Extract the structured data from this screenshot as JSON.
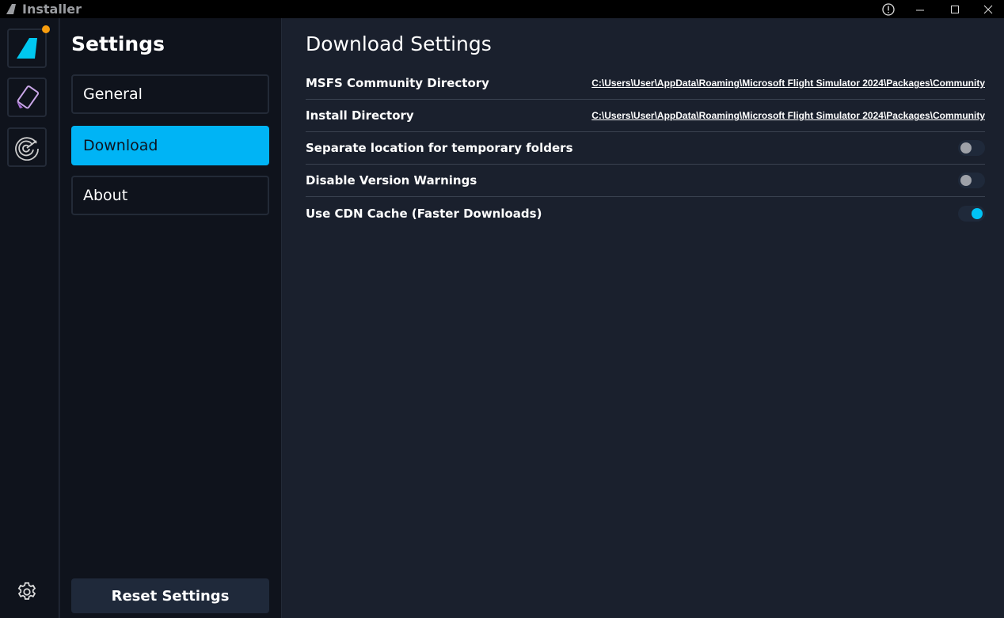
{
  "window": {
    "title": "Installer",
    "controls": [
      "info",
      "minimize",
      "maximize",
      "close"
    ]
  },
  "rail": {
    "items": [
      {
        "icon": "flybywire-logo-icon",
        "badge": true,
        "badge_color": "#f89d0e"
      },
      {
        "icon": "tablet-icon"
      },
      {
        "icon": "radar-icon"
      }
    ],
    "settings_icon": "gear-icon"
  },
  "settings": {
    "title": "Settings",
    "nav": [
      {
        "label": "General",
        "active": false
      },
      {
        "label": "Download",
        "active": true
      },
      {
        "label": "About",
        "active": false
      }
    ],
    "reset_label": "Reset Settings"
  },
  "main": {
    "title": "Download Settings",
    "rows": [
      {
        "label": "MSFS Community Directory",
        "value": "C:\\Users\\User\\AppData\\Roaming\\Microsoft Flight Simulator 2024\\Packages\\Community"
      },
      {
        "label": "Install Directory",
        "value": "C:\\Users\\User\\AppData\\Roaming\\Microsoft Flight Simulator 2024\\Packages\\Community"
      },
      {
        "label": "Separate location for temporary folders",
        "toggle": false
      },
      {
        "label": "Disable Version Warnings",
        "toggle": false
      },
      {
        "label": "Use CDN Cache (Faster Downloads)",
        "toggle": true
      }
    ]
  },
  "colors": {
    "accent": "#00b4f5",
    "toggle_on": "#00c3f5"
  }
}
